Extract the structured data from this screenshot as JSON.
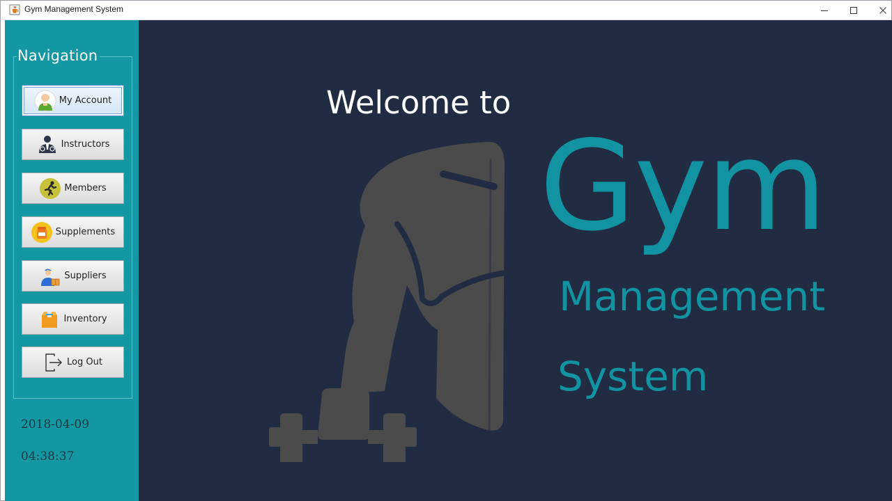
{
  "window": {
    "title": "Gym Management System"
  },
  "sidebar": {
    "nav_title": "Navigation",
    "buttons": [
      {
        "label": "My Account",
        "icon": "user-avatar-icon"
      },
      {
        "label": "Instructors",
        "icon": "instructor-icon"
      },
      {
        "label": "Members",
        "icon": "runner-icon"
      },
      {
        "label": "Supplements",
        "icon": "supplement-jar-icon"
      },
      {
        "label": "Suppliers",
        "icon": "delivery-person-icon"
      },
      {
        "label": "Inventory",
        "icon": "box-icon"
      },
      {
        "label": "Log Out",
        "icon": "logout-icon"
      }
    ],
    "date": "2018-04-09",
    "time": "04:38:37"
  },
  "main": {
    "welcome": "Welcome to",
    "logo_line1": "Gym",
    "logo_line2": "Management",
    "logo_line3": "System"
  },
  "colors": {
    "sidebar_bg": "#1297a3",
    "main_bg": "#212b42",
    "accent": "#1293a1",
    "figure": "#4a4a4a"
  }
}
